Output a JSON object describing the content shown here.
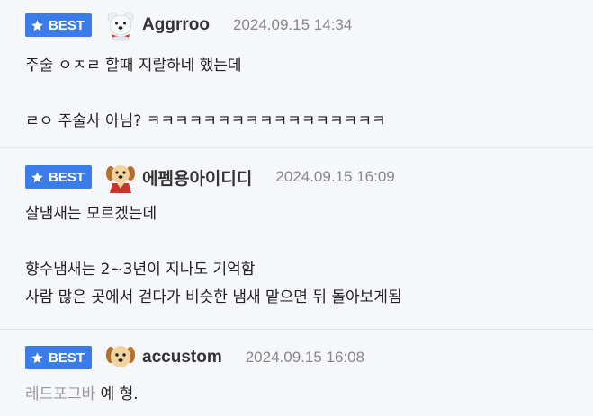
{
  "badge_label": "BEST",
  "colors": {
    "badge": "#3b7bea",
    "background": "#f5f7fb"
  },
  "comments": [
    {
      "avatar": "polar-bear-icon",
      "nickname": "Aggrroo",
      "timestamp": "2024.09.15 14:34",
      "lines": [
        "주술 ㅇㅈㄹ 할때 지랄하네 했는데",
        "",
        "ㄹㅇ 주술사 아님? ㅋㅋㅋㅋㅋㅋㅋㅋㅋㅋㅋㅋㅋㅋㅋㅋㅋ"
      ]
    },
    {
      "avatar": "puppy-icon",
      "nickname": "에펨용아이디디",
      "timestamp": "2024.09.15 16:09",
      "lines": [
        "살냄새는 모르겠는데",
        "",
        "향수냄새는 2~3년이 지나도 기억함",
        "사람 많은 곳에서 걷다가 비슷한 냄새 맡으면 뒤 돌아보게됨"
      ]
    },
    {
      "avatar": "puppy-icon",
      "nickname": "accustom",
      "timestamp": "2024.09.15 16:08",
      "reply_to": "레드포그바",
      "text": " 예 형."
    }
  ]
}
